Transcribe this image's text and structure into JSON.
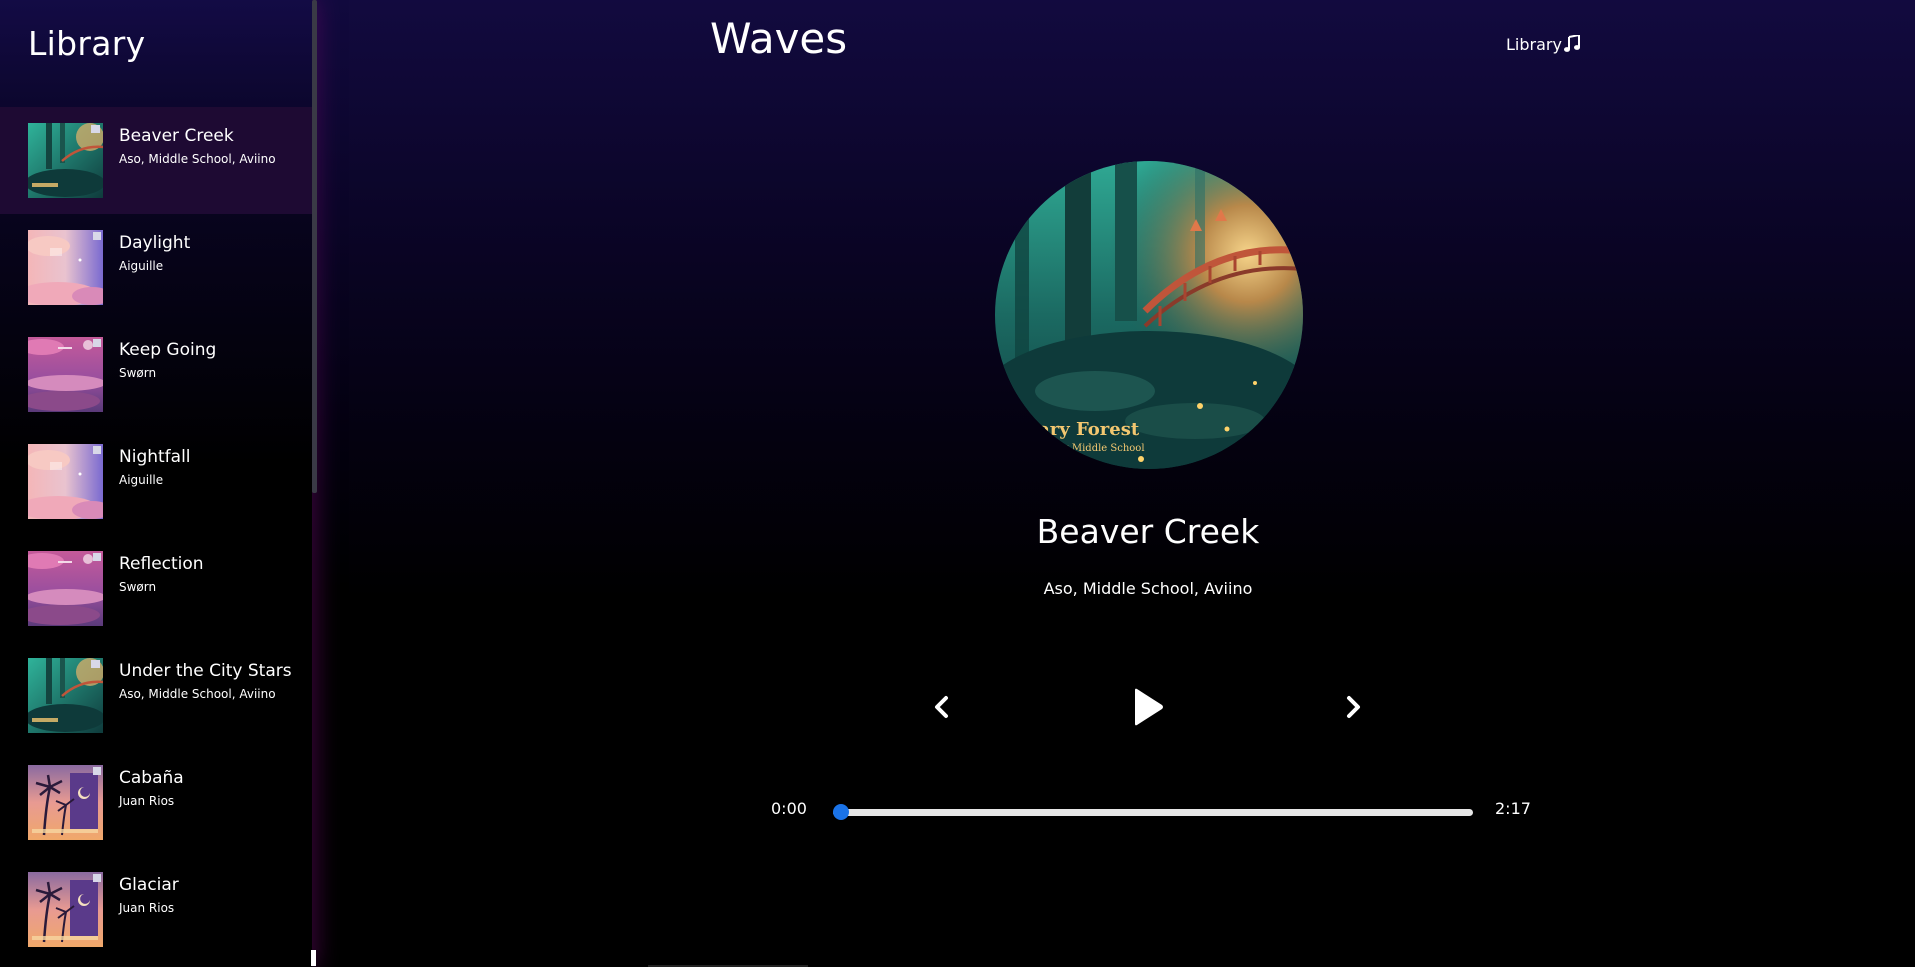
{
  "sidebar": {
    "title": "Library",
    "songs": [
      {
        "name": "Beaver Creek",
        "artist": "Aso, Middle School, Aviino",
        "active": true,
        "cover": "forest"
      },
      {
        "name": "Daylight",
        "artist": "Aiguille",
        "active": false,
        "cover": "pink-sky"
      },
      {
        "name": "Keep Going",
        "artist": "Swørn",
        "active": false,
        "cover": "magenta-sky"
      },
      {
        "name": "Nightfall",
        "artist": "Aiguille",
        "active": false,
        "cover": "pink-sky"
      },
      {
        "name": "Reflection",
        "artist": "Swørn",
        "active": false,
        "cover": "magenta-sky"
      },
      {
        "name": "Under the City Stars",
        "artist": "Aso, Middle School, Aviino",
        "active": false,
        "cover": "forest"
      },
      {
        "name": "Cabaña",
        "artist": "Juan Rios",
        "active": false,
        "cover": "palms"
      },
      {
        "name": "Glaciar",
        "artist": "Juan Rios",
        "active": false,
        "cover": "palms"
      }
    ]
  },
  "header": {
    "title": "Waves",
    "library_button_label": "Library",
    "library_icon": "music-note-icon"
  },
  "player": {
    "title": "Beaver Creek",
    "artist": "Aso, Middle School, Aviino",
    "album_art_text_line1": "nary Forest",
    "album_art_text_line2": "iino x Middle School",
    "current_time": "0:00",
    "total_time": "2:17",
    "progress_fraction": 0,
    "controls": {
      "prev_icon": "chevron-left-icon",
      "play_icon": "play-icon",
      "next_icon": "chevron-right-icon"
    }
  },
  "colors": {
    "accent": "#1a73e8",
    "active_row": "#1e0a33",
    "background_top": "#120a3f"
  }
}
